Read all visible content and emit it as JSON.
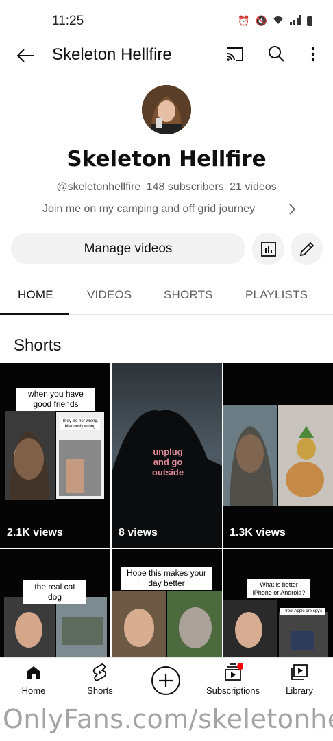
{
  "status_bar": {
    "time": "11:25"
  },
  "app_bar": {
    "title": "Skeleton Hellfire"
  },
  "channel": {
    "name": "Skeleton Hellfire",
    "handle": "@skeletonhellfire",
    "subscribers": "148 subscribers",
    "videos": "21 videos",
    "description": "Join me on my camping and off grid journey"
  },
  "actions": {
    "manage_label": "Manage videos"
  },
  "tabs": [
    "HOME",
    "VIDEOS",
    "SHORTS",
    "PLAYLISTS"
  ],
  "section": {
    "title": "Shorts"
  },
  "shorts": [
    {
      "caption": "when you have good friends",
      "inner_caption": "They did her wrong. hilariously wrong",
      "views": "2.1K views"
    },
    {
      "caption": "unplug and go outside",
      "views": "8 views"
    },
    {
      "views": "1.3K views"
    },
    {
      "caption": "the real cat dog"
    },
    {
      "caption": "Hope this makes your day better"
    },
    {
      "caption": "What is better iPhone or Android?",
      "inner_caption": "Proof Apple are spy's"
    }
  ],
  "bottom_nav": {
    "home": "Home",
    "shorts": "Shorts",
    "subscriptions": "Subscriptions",
    "library": "Library"
  },
  "watermark": "OnlyFans.com/skeletonhe",
  "colors": {
    "accent": "#0f0f0f",
    "chip_bg": "#f2f2f2",
    "notification_dot": "#ff0000"
  }
}
